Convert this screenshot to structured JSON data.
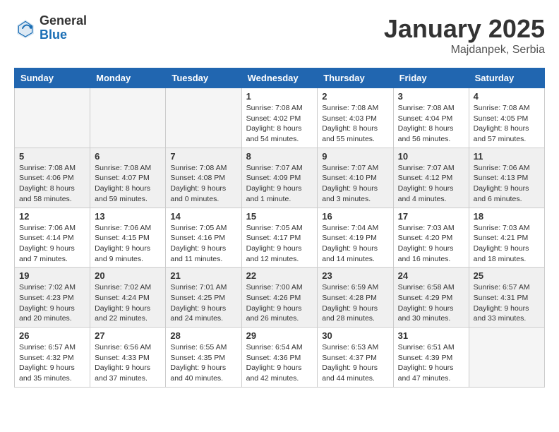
{
  "header": {
    "logo_general": "General",
    "logo_blue": "Blue",
    "title": "January 2025",
    "subtitle": "Majdanpek, Serbia"
  },
  "weekdays": [
    "Sunday",
    "Monday",
    "Tuesday",
    "Wednesday",
    "Thursday",
    "Friday",
    "Saturday"
  ],
  "weeks": [
    [
      {
        "day": "",
        "info": ""
      },
      {
        "day": "",
        "info": ""
      },
      {
        "day": "",
        "info": ""
      },
      {
        "day": "1",
        "info": "Sunrise: 7:08 AM\nSunset: 4:02 PM\nDaylight: 8 hours\nand 54 minutes."
      },
      {
        "day": "2",
        "info": "Sunrise: 7:08 AM\nSunset: 4:03 PM\nDaylight: 8 hours\nand 55 minutes."
      },
      {
        "day": "3",
        "info": "Sunrise: 7:08 AM\nSunset: 4:04 PM\nDaylight: 8 hours\nand 56 minutes."
      },
      {
        "day": "4",
        "info": "Sunrise: 7:08 AM\nSunset: 4:05 PM\nDaylight: 8 hours\nand 57 minutes."
      }
    ],
    [
      {
        "day": "5",
        "info": "Sunrise: 7:08 AM\nSunset: 4:06 PM\nDaylight: 8 hours\nand 58 minutes."
      },
      {
        "day": "6",
        "info": "Sunrise: 7:08 AM\nSunset: 4:07 PM\nDaylight: 8 hours\nand 59 minutes."
      },
      {
        "day": "7",
        "info": "Sunrise: 7:08 AM\nSunset: 4:08 PM\nDaylight: 9 hours\nand 0 minutes."
      },
      {
        "day": "8",
        "info": "Sunrise: 7:07 AM\nSunset: 4:09 PM\nDaylight: 9 hours\nand 1 minute."
      },
      {
        "day": "9",
        "info": "Sunrise: 7:07 AM\nSunset: 4:10 PM\nDaylight: 9 hours\nand 3 minutes."
      },
      {
        "day": "10",
        "info": "Sunrise: 7:07 AM\nSunset: 4:12 PM\nDaylight: 9 hours\nand 4 minutes."
      },
      {
        "day": "11",
        "info": "Sunrise: 7:06 AM\nSunset: 4:13 PM\nDaylight: 9 hours\nand 6 minutes."
      }
    ],
    [
      {
        "day": "12",
        "info": "Sunrise: 7:06 AM\nSunset: 4:14 PM\nDaylight: 9 hours\nand 7 minutes."
      },
      {
        "day": "13",
        "info": "Sunrise: 7:06 AM\nSunset: 4:15 PM\nDaylight: 9 hours\nand 9 minutes."
      },
      {
        "day": "14",
        "info": "Sunrise: 7:05 AM\nSunset: 4:16 PM\nDaylight: 9 hours\nand 11 minutes."
      },
      {
        "day": "15",
        "info": "Sunrise: 7:05 AM\nSunset: 4:17 PM\nDaylight: 9 hours\nand 12 minutes."
      },
      {
        "day": "16",
        "info": "Sunrise: 7:04 AM\nSunset: 4:19 PM\nDaylight: 9 hours\nand 14 minutes."
      },
      {
        "day": "17",
        "info": "Sunrise: 7:03 AM\nSunset: 4:20 PM\nDaylight: 9 hours\nand 16 minutes."
      },
      {
        "day": "18",
        "info": "Sunrise: 7:03 AM\nSunset: 4:21 PM\nDaylight: 9 hours\nand 18 minutes."
      }
    ],
    [
      {
        "day": "19",
        "info": "Sunrise: 7:02 AM\nSunset: 4:23 PM\nDaylight: 9 hours\nand 20 minutes."
      },
      {
        "day": "20",
        "info": "Sunrise: 7:02 AM\nSunset: 4:24 PM\nDaylight: 9 hours\nand 22 minutes."
      },
      {
        "day": "21",
        "info": "Sunrise: 7:01 AM\nSunset: 4:25 PM\nDaylight: 9 hours\nand 24 minutes."
      },
      {
        "day": "22",
        "info": "Sunrise: 7:00 AM\nSunset: 4:26 PM\nDaylight: 9 hours\nand 26 minutes."
      },
      {
        "day": "23",
        "info": "Sunrise: 6:59 AM\nSunset: 4:28 PM\nDaylight: 9 hours\nand 28 minutes."
      },
      {
        "day": "24",
        "info": "Sunrise: 6:58 AM\nSunset: 4:29 PM\nDaylight: 9 hours\nand 30 minutes."
      },
      {
        "day": "25",
        "info": "Sunrise: 6:57 AM\nSunset: 4:31 PM\nDaylight: 9 hours\nand 33 minutes."
      }
    ],
    [
      {
        "day": "26",
        "info": "Sunrise: 6:57 AM\nSunset: 4:32 PM\nDaylight: 9 hours\nand 35 minutes."
      },
      {
        "day": "27",
        "info": "Sunrise: 6:56 AM\nSunset: 4:33 PM\nDaylight: 9 hours\nand 37 minutes."
      },
      {
        "day": "28",
        "info": "Sunrise: 6:55 AM\nSunset: 4:35 PM\nDaylight: 9 hours\nand 40 minutes."
      },
      {
        "day": "29",
        "info": "Sunrise: 6:54 AM\nSunset: 4:36 PM\nDaylight: 9 hours\nand 42 minutes."
      },
      {
        "day": "30",
        "info": "Sunrise: 6:53 AM\nSunset: 4:37 PM\nDaylight: 9 hours\nand 44 minutes."
      },
      {
        "day": "31",
        "info": "Sunrise: 6:51 AM\nSunset: 4:39 PM\nDaylight: 9 hours\nand 47 minutes."
      },
      {
        "day": "",
        "info": ""
      }
    ]
  ]
}
